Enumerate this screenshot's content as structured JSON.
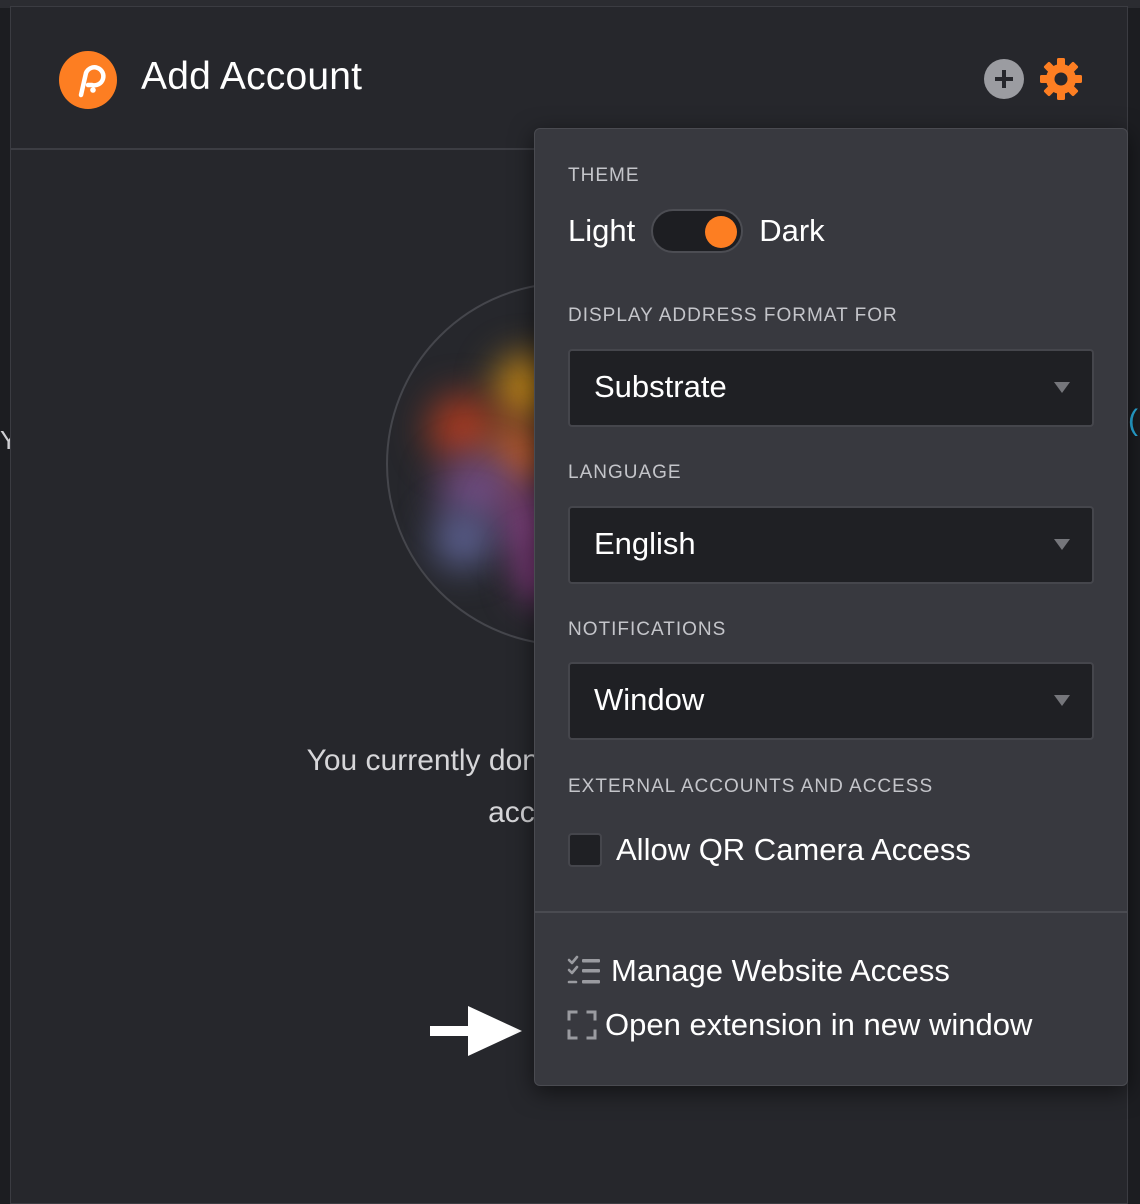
{
  "header": {
    "title": "Add Account",
    "logo_icon": "polkadot-logo-icon",
    "add_icon": "plus-circle-icon",
    "settings_icon": "gear-icon",
    "accent_color": "#fd7e22"
  },
  "main": {
    "empty_line1": "You currently don't have a",
    "empty_line2": "account t",
    "edge_left_text": "Y",
    "edge_right_text": "("
  },
  "settings_menu": {
    "theme": {
      "label": "THEME",
      "light_label": "Light",
      "dark_label": "Dark",
      "selected": "Dark"
    },
    "address_format": {
      "label": "DISPLAY ADDRESS FORMAT FOR",
      "value": "Substrate"
    },
    "language": {
      "label": "LANGUAGE",
      "value": "English"
    },
    "notifications": {
      "label": "NOTIFICATIONS",
      "value": "Window"
    },
    "external": {
      "label": "EXTERNAL ACCOUNTS AND ACCESS",
      "qr_label": "Allow QR Camera Access",
      "qr_checked": false
    },
    "links": {
      "manage_label": "Manage Website Access",
      "manage_icon": "checklist-icon",
      "open_window_label": "Open extension in new window",
      "open_window_icon": "expand-icon"
    }
  },
  "annotation": {
    "arrow_icon": "arrow-right-icon"
  }
}
